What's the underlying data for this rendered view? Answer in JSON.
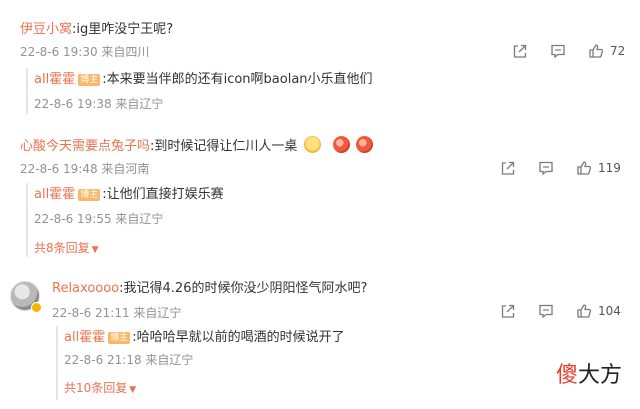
{
  "comments": [
    {
      "user": "伊豆小窝",
      "text": ":ig里咋没宁王呢?",
      "meta": "22-8-6 19:30 来自四川",
      "likes": "72",
      "reply": {
        "user": "all霍霍",
        "tag": "博主",
        "text": ":本来要当伴郎的还有icon啊baolan小乐直他们",
        "meta": "22-8-6 19:38 来自辽宁"
      }
    },
    {
      "user": "心酸今天需要点兔子吗",
      "text": ":到时候记得让仁川人一桌",
      "meta": "22-8-6 19:48 来自河南",
      "likes": "119",
      "emojis": [
        "cat-face-emoji",
        "blush-emoji",
        "blush-emoji"
      ],
      "reply": {
        "user": "all霍霍",
        "tag": "博主",
        "text": ":让他们直接打娱乐赛",
        "meta": "22-8-6 19:55 来自辽宁"
      },
      "more": "共8条回复"
    },
    {
      "user": "Relaxoooo",
      "text": ":我记得4.26的时候你没少阴阳怪气阿水吧?",
      "meta": "22-8-6 21:11 来自辽宁",
      "likes": "104",
      "reply": {
        "user": "all霍霍",
        "tag": "博主",
        "text": ":哈哈哈早就以前的喝酒的时候说开了",
        "meta": "22-8-6 21:18 来自辽宁"
      },
      "more": "共10条回复"
    }
  ],
  "watermark": {
    "part1": "傻",
    "part2": "大方"
  },
  "colors": {
    "username": "#eb7350",
    "meta": "#939393",
    "tag": "#f7b86a"
  }
}
